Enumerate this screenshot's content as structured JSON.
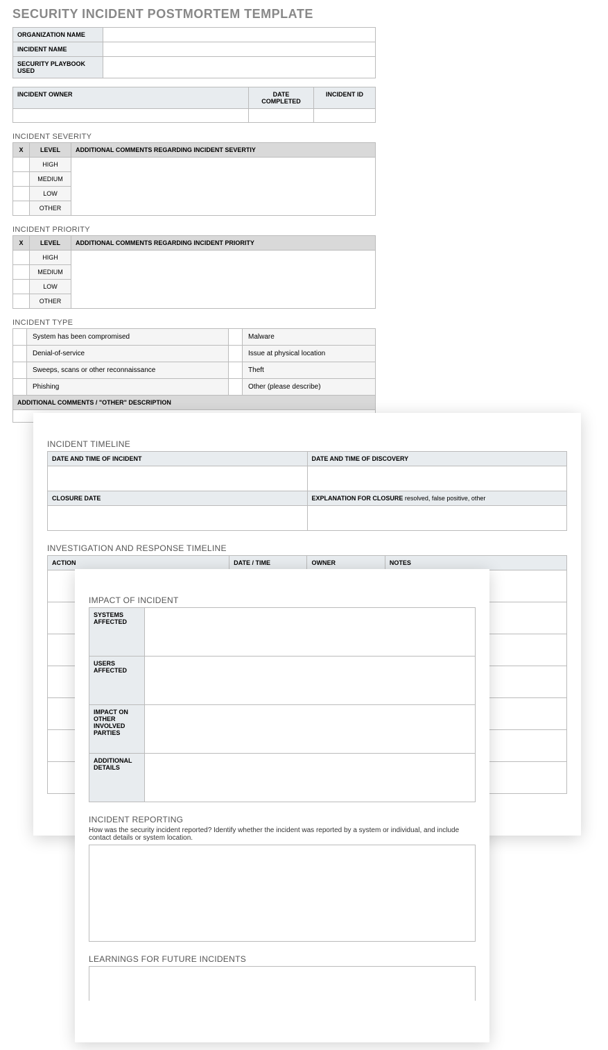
{
  "title": "SECURITY INCIDENT POSTMORTEM TEMPLATE",
  "org_table": {
    "rows": [
      {
        "label": "ORGANIZATION NAME",
        "value": ""
      },
      {
        "label": "INCIDENT NAME",
        "value": ""
      },
      {
        "label": "SECURITY PLAYBOOK USED",
        "value": ""
      }
    ]
  },
  "meta_table": {
    "headers": [
      "INCIDENT OWNER",
      "DATE COMPLETED",
      "INCIDENT ID"
    ],
    "values": [
      "",
      "",
      ""
    ]
  },
  "severity": {
    "title": "INCIDENT SEVERITY",
    "col_x": "X",
    "col_level": "LEVEL",
    "col_comments": "ADDITIONAL COMMENTS REGARDING INCIDENT SEVERTIY",
    "levels": [
      "HIGH",
      "MEDIUM",
      "LOW",
      "OTHER"
    ],
    "comments": ""
  },
  "priority": {
    "title": "INCIDENT PRIORITY",
    "col_x": "X",
    "col_level": "LEVEL",
    "col_comments": "ADDITIONAL COMMENTS REGARDING INCIDENT PRIORITY",
    "levels": [
      "HIGH",
      "MEDIUM",
      "LOW",
      "OTHER"
    ],
    "comments": ""
  },
  "incident_type": {
    "title": "INCIDENT TYPE",
    "left": [
      "System has been compromised",
      "Denial-of-service",
      "Sweeps, scans or other reconnaissance",
      "Phishing"
    ],
    "right": [
      "Malware",
      "Issue at physical location",
      "Theft",
      "Other (please describe)"
    ],
    "additional_label": "ADDITIONAL COMMENTS / \"OTHER\" DESCRIPTION",
    "additional_value": ""
  },
  "timeline": {
    "title": "INCIDENT TIMELINE",
    "h1": "DATE AND TIME OF INCIDENT",
    "h2": "DATE AND TIME OF DISCOVERY",
    "h3": "CLOSURE DATE",
    "h4": "EXPLANATION FOR CLOSURE",
    "h4_note": "  resolved, false positive, other",
    "v1": "",
    "v2": "",
    "v3": "",
    "v4": ""
  },
  "investigation": {
    "title": "INVESTIGATION AND RESPONSE TIMELINE",
    "cols": [
      "ACTION",
      "DATE / TIME",
      "OWNER",
      "NOTES"
    ]
  },
  "impact": {
    "title": "IMPACT OF INCIDENT",
    "rows": [
      {
        "label": "SYSTEMS AFFECTED",
        "value": ""
      },
      {
        "label": "USERS AFFECTED",
        "value": ""
      },
      {
        "label": "IMPACT ON OTHER INVOLVED PARTIES",
        "value": ""
      },
      {
        "label": "ADDITIONAL DETAILS",
        "value": ""
      }
    ]
  },
  "reporting": {
    "title": "INCIDENT REPORTING",
    "desc": "How was the security incident reported? Identify whether the incident was reported by a system or individual, and include contact details or system location.",
    "value": ""
  },
  "learnings": {
    "title": "LEARNINGS FOR FUTURE INCIDENTS",
    "value": ""
  }
}
